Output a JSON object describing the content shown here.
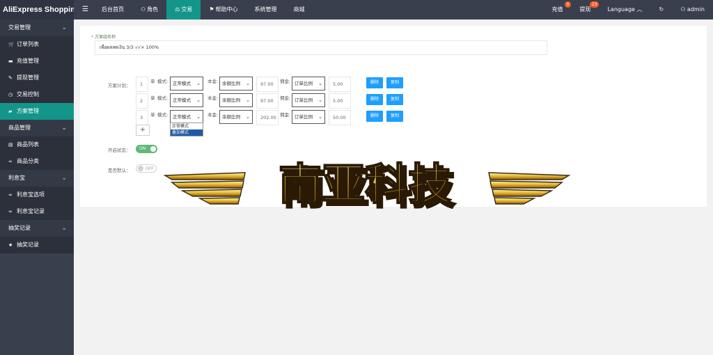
{
  "brand": "AliExpress Shopping...",
  "topnav": {
    "items": [
      {
        "label": "后台首页",
        "icon": ""
      },
      {
        "label": "角色",
        "icon": "user-icon"
      },
      {
        "label": "交易",
        "icon": "scale-icon",
        "active": true
      },
      {
        "label": "帮助中心",
        "icon": "flag-icon"
      },
      {
        "label": "系统管理",
        "icon": ""
      },
      {
        "label": "商城",
        "icon": ""
      }
    ],
    "recharge": {
      "label": "充值",
      "badge": "0"
    },
    "withdraw": {
      "label": "提现",
      "badge": "23"
    },
    "language": "Language",
    "user": "admin"
  },
  "sidebar": {
    "groups": [
      {
        "label": "交易管理",
        "items": [
          {
            "label": "订单列表",
            "icon": "cart-icon"
          },
          {
            "label": "充值管理",
            "icon": "comment-icon"
          },
          {
            "label": "提现管理",
            "icon": "gavel-icon"
          },
          {
            "label": "交易控制",
            "icon": "dashboard-icon"
          },
          {
            "label": "方案管理",
            "icon": "folder-icon",
            "active": true
          }
        ]
      },
      {
        "label": "商品管理",
        "items": [
          {
            "label": "商品列表",
            "icon": "list-icon"
          },
          {
            "label": "商品分类",
            "icon": "link-icon"
          }
        ]
      },
      {
        "label": "利息宝",
        "items": [
          {
            "label": "利息宝选项",
            "icon": "link-icon"
          },
          {
            "label": "利息宝记录",
            "icon": "link-icon"
          }
        ]
      },
      {
        "label": "抽奖记录",
        "items": [
          {
            "label": "抽奖记录",
            "icon": "star-icon"
          }
        ]
      }
    ]
  },
  "form": {
    "name_label": "方案组名称",
    "name_value": "เพื่อผลลดเงิน 3/3 √√× 100%",
    "plan_label": "方案计划：",
    "rows": [
      {
        "index": "1",
        "unit": "单",
        "mode_label": "模式:",
        "mode": "正常模式",
        "principal_label": "本金:",
        "principal_mode": "余额比例",
        "principal_value": "97.00",
        "commission_label": "佣金:",
        "commission_mode": "订单比例",
        "commission_value": "5.00"
      },
      {
        "index": "2",
        "unit": "单",
        "mode_label": "模式:",
        "mode": "正常模式",
        "principal_label": "本金:",
        "principal_mode": "余额比例",
        "principal_value": "97.00",
        "commission_label": "佣金:",
        "commission_mode": "订单比例",
        "commission_value": "5.00"
      },
      {
        "index": "3",
        "unit": "单",
        "mode_label": "模式:",
        "mode": "正常模式",
        "principal_label": "本金:",
        "principal_mode": "余额比例",
        "principal_value": "202.00",
        "commission_label": "佣金:",
        "commission_mode": "订单比例",
        "commission_value": "50.00"
      }
    ],
    "delete_label": "删除",
    "copy_label": "复制",
    "add_label": "+",
    "mode_options": [
      "正常模式",
      "叠加模式"
    ],
    "status_label": "开启状态：",
    "status_toggle": "ON",
    "default_label": "是否默认：",
    "default_toggle": "OFF"
  },
  "watermark_text": "南亚科技",
  "colors": {
    "accent": "#14958a",
    "button": "#1e9fff",
    "sidebar": "#3a3f4e"
  }
}
